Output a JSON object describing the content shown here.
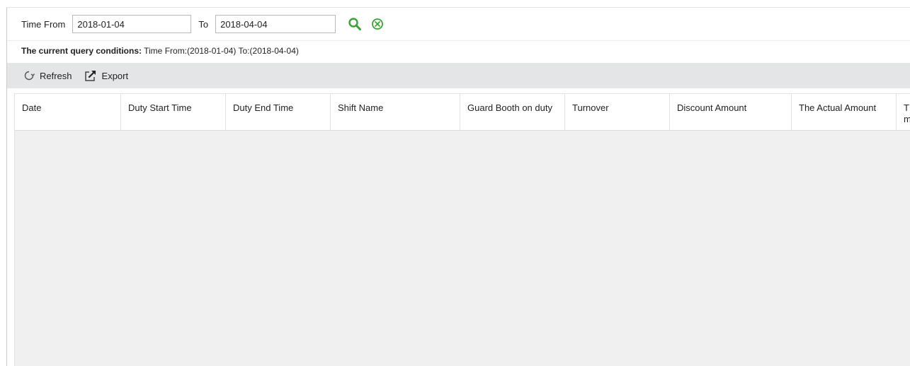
{
  "filter": {
    "time_from_label": "Time From",
    "time_from_value": "2018-01-04",
    "to_label": "To",
    "to_value": "2018-04-04"
  },
  "conditions": {
    "label": "The current query conditions:",
    "value": " Time From:(2018-01-04)  To:(2018-04-04)"
  },
  "toolbar": {
    "refresh_label": "Refresh",
    "export_label": "Export"
  },
  "table": {
    "columns": [
      "Date",
      "Duty Start Time",
      "Duty End Time",
      "Shift Name",
      "Guard Booth on duty",
      "Turnover",
      "Discount Amount",
      "The Actual Amount",
      "T\nm"
    ],
    "rows": []
  },
  "colors": {
    "search_icon": "#3aa335",
    "clear_icon": "#3aa335",
    "toolbar_bg": "#e3e5e7",
    "grid_body_bg": "#f0f0f0"
  },
  "icons": {
    "search": "search-icon",
    "clear": "clear-circle-x-icon",
    "refresh": "refresh-icon",
    "export": "export-icon"
  }
}
